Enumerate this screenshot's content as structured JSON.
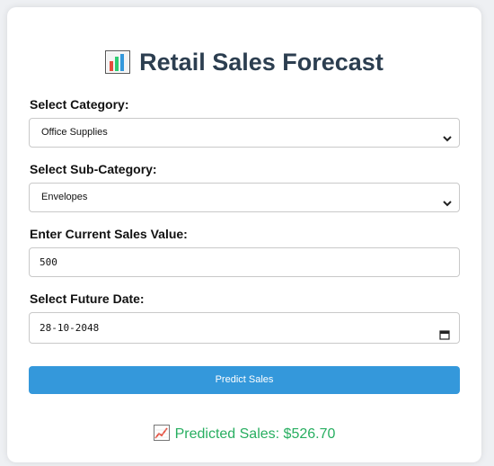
{
  "header": {
    "title": "Retail Sales Forecast",
    "icon": "bar-chart-icon"
  },
  "form": {
    "category_label": "Select Category:",
    "category_value": "Office Supplies",
    "subcategory_label": "Select Sub-Category:",
    "subcategory_value": "Envelopes",
    "sales_label": "Enter Current Sales Value:",
    "sales_value": "500",
    "date_label": "Select Future Date:",
    "date_value": "28-10-2048",
    "submit_label": "Predict Sales"
  },
  "result": {
    "icon": "chart-increasing-icon",
    "text": "Predicted Sales: $526.70"
  },
  "colors": {
    "accent": "#3498db",
    "title": "#2c3e50",
    "success": "#27ae60"
  }
}
